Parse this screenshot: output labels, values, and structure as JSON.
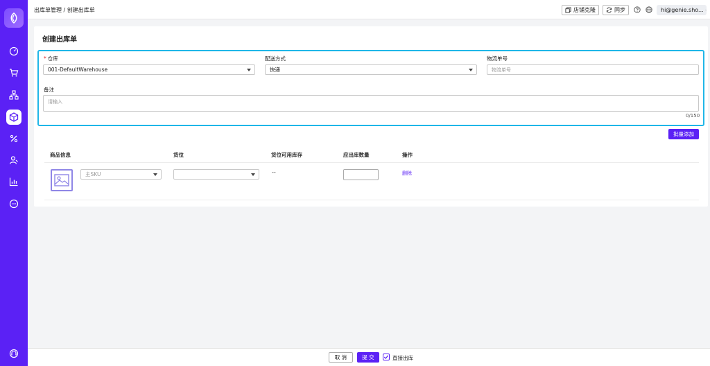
{
  "breadcrumb": {
    "parent": "出库单管理",
    "separator": " / ",
    "current": "创建出库单"
  },
  "topbar": {
    "store_clone_label": "店铺克隆",
    "sync_label": "同步",
    "user_email": "hi@genie.sho..."
  },
  "sidebar": {
    "items": [
      {
        "icon": "dashboard-icon",
        "active": false
      },
      {
        "icon": "cart-icon",
        "active": false
      },
      {
        "icon": "hierarchy-icon",
        "active": false
      },
      {
        "icon": "box-icon",
        "active": true
      },
      {
        "icon": "percent-icon",
        "active": false
      },
      {
        "icon": "users-icon",
        "active": false
      },
      {
        "icon": "chart-icon",
        "active": false
      },
      {
        "icon": "chat-icon",
        "active": false
      }
    ],
    "bottom_icon": "headset-icon"
  },
  "page": {
    "title": "创建出库单"
  },
  "form": {
    "warehouse_label": "仓库",
    "warehouse_value": "001-DefaultWarehouse",
    "shipping_label": "配送方式",
    "shipping_value": "快递",
    "tracking_label": "物流单号",
    "tracking_placeholder": "物流单号",
    "remark_label": "备注",
    "remark_placeholder": "请输入",
    "remark_counter": "0/150"
  },
  "batch_add_label": "批量添加",
  "table": {
    "headers": [
      "商品信息",
      "货位",
      "货位可用库存",
      "应出库数量",
      "操作"
    ],
    "row": {
      "sku_placeholder": "主SKU",
      "location_value": "",
      "available_stock": "--",
      "quantity": "",
      "action": "删除"
    }
  },
  "footer": {
    "cancel_label": "取 消",
    "submit_label": "提 交",
    "direct_out_label": "直接出库",
    "direct_out_checked": true
  },
  "colors": {
    "primary": "#5b21f5",
    "highlight": "#1fb6e8"
  }
}
